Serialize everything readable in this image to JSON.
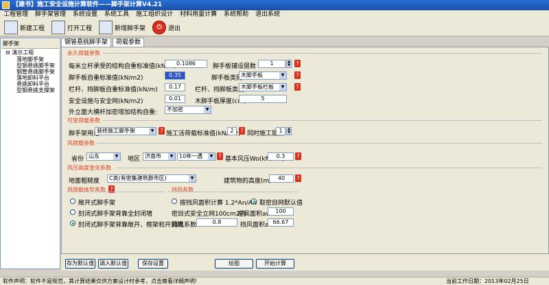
{
  "window": {
    "title": "【建书】施工安全设施计算软件——脚手架计算V4.21"
  },
  "menu": [
    "工程管理",
    "脚手架管理",
    "系统设置",
    "系统工具",
    "施工组织设计",
    "材料用量计算",
    "系统帮助",
    "退出系统"
  ],
  "toolbar": {
    "new_project": "新建工程",
    "open_project": "打开工程",
    "new_scaffold": "新增脚手架",
    "exit": "退出",
    "exit_icon": "power-icon"
  },
  "tree": {
    "header": "脚手架",
    "root": "演示工程",
    "items": [
      "落地脚手架",
      "型钢悬挑脚手架",
      "钢管悬挑脚手架",
      "落地卸料平台",
      "悬挑卸料平台",
      "型钢悬挑支撑架"
    ]
  },
  "tabs": [
    "钢管悬挑脚手架",
    "荷载参数"
  ],
  "permanent": {
    "title": "永久荷载参数",
    "steel_weight_label": "每米立杆承受的结构自重标准值(kN/m)",
    "steel_weight": "0.1086",
    "board_layers_label": "脚手板铺设层数",
    "board_layers": "1",
    "board_weight_label": "脚手板自重标准值(kN/m2)",
    "board_weight": "0.35",
    "board_type_label": "脚手板类别",
    "board_type": "木脚手板",
    "rail_weight_label": "栏杆、挡脚板自重标准值(kN/m)",
    "rail_weight": "0.17",
    "rail_type_label": "栏杆、挡脚板类别",
    "rail_type": "木脚手板栏板",
    "safety_net_label": "安全设施与安全网(kN/m2)",
    "safety_net": "0.01",
    "board_thick_label": "木脚手板厚度(cm)",
    "board_thick": "5",
    "outer_bar_label": "外立面大横杆加密增加结构自重:",
    "outer_bar": "不加密"
  },
  "variable": {
    "title": "可变荷载参数",
    "use_label": "脚手架用途",
    "use": "装修施工脚手架",
    "live_load_label": "施工活荷载标准值(kN/m2)",
    "live_load": "2",
    "layers_label": "同时施工层数",
    "layers": "1"
  },
  "wind": {
    "title": "风荷载参数",
    "province_label": "省份",
    "province": "山东",
    "region_label": "地区",
    "region": "济南市",
    "return_period": "10年一遇",
    "pressure_label": "基本风压Wo(kN/m2)",
    "pressure": "0.3"
  },
  "height": {
    "title": "风压高度变化系数",
    "rough_label": "地面粗糙度",
    "rough": "C类(有密集建筑群市区)",
    "building_label": "建筑物的高度(m):",
    "building": "40"
  },
  "shape": {
    "title": "风荷载体型系数",
    "opt1": "敞开式脚手架",
    "opt2": "封闭式脚手架背靠全封闭墙",
    "opt3": "封闭式脚手架背靠敞开、框架和开洞墙"
  },
  "wind_coef": {
    "title": "挡风系数",
    "calc_label": "按挡风面积计算 1.2*An/Aw",
    "default_label": "取密目网默认值",
    "mesh_label": "密目式安全立网100cm2内:",
    "mesh_area_label": "迎风面积aw",
    "mesh_area": "100",
    "coef_label": "挡风系数",
    "coef": "0.8",
    "an_label": "挡风面积an",
    "an": "66.67"
  },
  "buttons": {
    "save_default": "存为默认值",
    "load_default": "调入默认值",
    "save_setting": "保存设置",
    "draw": "绘图",
    "calculate": "开始计算"
  },
  "status": {
    "left": "软件声明：软件不是规范，其计算结果仅供方案设计时参考，点击察看详细声明!",
    "right": "当前工作日期：2013年02月25日"
  }
}
